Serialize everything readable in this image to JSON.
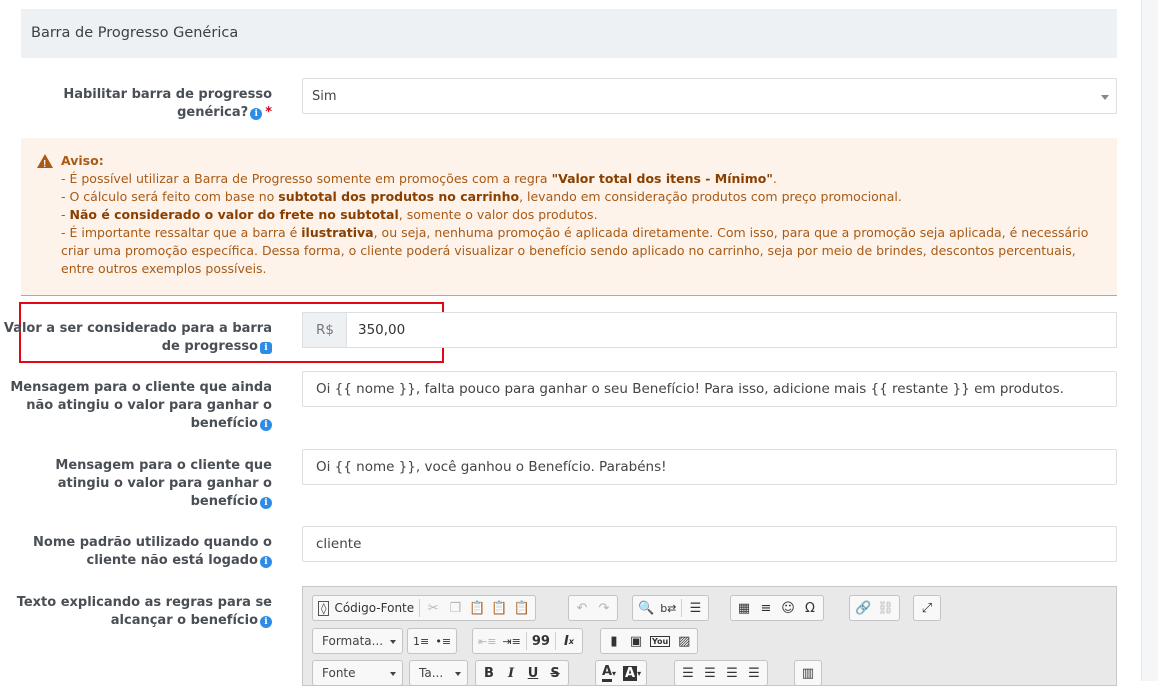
{
  "section": {
    "title": "Barra de Progresso Genérica"
  },
  "enable_field": {
    "label_line1": "Habilitar barra de progresso",
    "label_line2": "genérica?",
    "required_mark": "*",
    "value": "Sim"
  },
  "alert": {
    "title": "Aviso:",
    "line1_pre": "- É possível utilizar a Barra de Progresso somente em promoções com a regra ",
    "line1_bold": "\"Valor total dos itens - Mínimo\"",
    "line1_post": ".",
    "line2_pre": "- O cálculo será feito com base no ",
    "line2_bold": "subtotal dos produtos no carrinho",
    "line2_post": ", levando em consideração produtos com preço promocional.",
    "line3_pre": "- ",
    "line3_bold": "Não é considerado o valor do frete no subtotal",
    "line3_post": ", somente o valor dos produtos.",
    "line4_pre": "- É importante ressaltar que a barra é ",
    "line4_bold": "ilustrativa",
    "line4_post": ", ou seja, nenhuma promoção é aplicada diretamente. Com isso, para que a promoção seja aplicada, é necessário",
    "line5": "criar uma promoção específica. Dessa forma, o cliente poderá visualizar o benefício sendo aplicado no carrinho, seja por meio de brindes, descontos percentuais,",
    "line6": "entre outros exemplos possíveis."
  },
  "value_field": {
    "label_line1": "Valor a ser considerado para a barra",
    "label_line2": "de progresso",
    "currency": "R$",
    "value": "350,00"
  },
  "msg_pending": {
    "label_line1": "Mensagem para o cliente que ainda",
    "label_line2": "não atingiu o valor para ganhar o",
    "label_line3": "benefício",
    "value": "Oi {{ nome }}, falta pouco para ganhar o seu Benefício! Para isso, adicione mais {{ restante }} em produtos."
  },
  "msg_reached": {
    "label_line1": "Mensagem para o cliente que",
    "label_line2": "atingiu o valor para ganhar o",
    "label_line3": "benefício",
    "value": "Oi {{ nome }}, você ganhou o Benefício. Parabéns!"
  },
  "default_name": {
    "label_line1": "Nome padrão utilizado quando o",
    "label_line2": "cliente não está logado",
    "value": "cliente"
  },
  "rules_text": {
    "label_line1": "Texto explicando as regras para se",
    "label_line2": "alcançar o benefício"
  },
  "editor": {
    "source_label": "Código-Fonte",
    "format_label": "Formata...",
    "font_label": "Fonte",
    "size_label": "Ta...",
    "bold": "B",
    "italic": "I",
    "underline": "U",
    "strike": "S",
    "quote": "99",
    "omega": "Ω",
    "text_color": "A",
    "bg_color": "A",
    "youtube": "You"
  }
}
